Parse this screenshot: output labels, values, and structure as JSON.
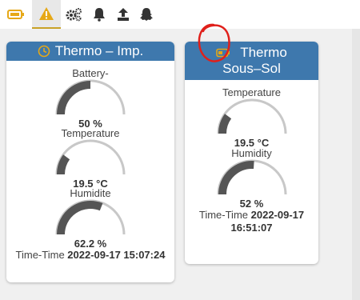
{
  "toolbar": {
    "tabs": [
      {
        "icon": "battery-icon",
        "active": false
      },
      {
        "icon": "warning-icon",
        "active": true
      },
      {
        "icon": "gears-icon",
        "active": false
      },
      {
        "icon": "bell-icon",
        "active": false
      },
      {
        "icon": "upload-icon",
        "active": false
      },
      {
        "icon": "snapchat-ghost-icon",
        "active": false
      }
    ]
  },
  "colors": {
    "header": "#3e78ad",
    "gauge_fill": "#555555",
    "gauge_track": "#c8c8c8",
    "accent": "#e6a817",
    "annotation": "#e0201b"
  },
  "card1": {
    "title": "Thermo – Imp.",
    "header_icon": "clock-icon",
    "metrics": [
      {
        "label": "Battery-",
        "value": "50 %",
        "level": 0.5
      },
      {
        "label": "Temperature",
        "value": "19.5 °C",
        "level": 0.2
      },
      {
        "label": "Humidite",
        "value": "62.2 %",
        "level": 0.62
      }
    ],
    "time_label": "Time-Time",
    "time_value": "2022-09-17 15:07:24"
  },
  "card2": {
    "title_line1": "Thermo",
    "title_line2": "Sous–Sol",
    "header_icon": "battery-icon",
    "metrics": [
      {
        "label": "Temperature",
        "value": "19.5 °C",
        "level": 0.2
      },
      {
        "label": "Humidity",
        "value": "52 %",
        "level": 0.52
      }
    ],
    "time_label": "Time-Time",
    "time_value_date": "2022-09-17",
    "time_value_clock": "16:51:07"
  }
}
